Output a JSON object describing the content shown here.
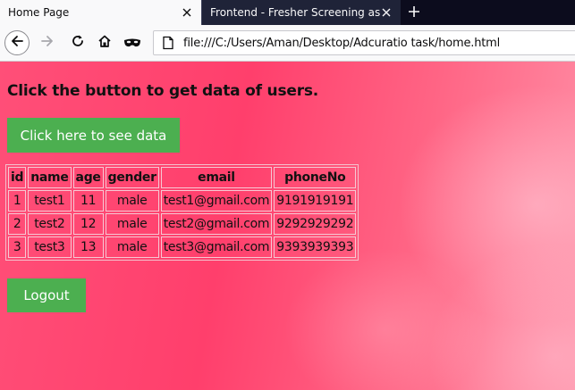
{
  "browser": {
    "tabs": [
      {
        "title": "Home Page",
        "active": true
      },
      {
        "title": "Frontend - Fresher Screening assig",
        "active": false
      }
    ],
    "url": "file:///C:/Users/Aman/Desktop/Adcuratio task/home.html",
    "icons": [
      "back-arrow-icon",
      "forward-arrow-icon",
      "reload-icon",
      "home-icon",
      "private-mask-icon",
      "page-icon",
      "close-icon",
      "plus-icon"
    ]
  },
  "page": {
    "heading": "Click the button to get data of users.",
    "see_data_label": "Click here to see data",
    "logout_label": "Logout",
    "colors": {
      "button": "#4caf50",
      "background": "#ff4f78"
    },
    "table": {
      "headers": [
        "id",
        "name",
        "age",
        "gender",
        "email",
        "phoneNo"
      ],
      "rows": [
        [
          "1",
          "test1",
          "11",
          "male",
          "test1@gmail.com",
          "9191919191"
        ],
        [
          "2",
          "test2",
          "12",
          "male",
          "test2@gmail.com",
          "9292929292"
        ],
        [
          "3",
          "test3",
          "13",
          "male",
          "test3@gmail.com",
          "9393939393"
        ]
      ]
    }
  }
}
